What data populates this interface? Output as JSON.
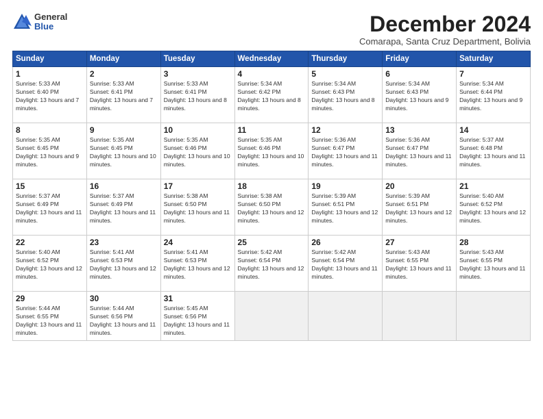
{
  "logo": {
    "general": "General",
    "blue": "Blue"
  },
  "title": "December 2024",
  "subtitle": "Comarapa, Santa Cruz Department, Bolivia",
  "days_of_week": [
    "Sunday",
    "Monday",
    "Tuesday",
    "Wednesday",
    "Thursday",
    "Friday",
    "Saturday"
  ],
  "weeks": [
    [
      {
        "day": 1,
        "sunrise": "5:33 AM",
        "sunset": "6:40 PM",
        "daylight": "13 hours and 7 minutes."
      },
      {
        "day": 2,
        "sunrise": "5:33 AM",
        "sunset": "6:41 PM",
        "daylight": "13 hours and 7 minutes."
      },
      {
        "day": 3,
        "sunrise": "5:33 AM",
        "sunset": "6:41 PM",
        "daylight": "13 hours and 8 minutes."
      },
      {
        "day": 4,
        "sunrise": "5:34 AM",
        "sunset": "6:42 PM",
        "daylight": "13 hours and 8 minutes."
      },
      {
        "day": 5,
        "sunrise": "5:34 AM",
        "sunset": "6:43 PM",
        "daylight": "13 hours and 8 minutes."
      },
      {
        "day": 6,
        "sunrise": "5:34 AM",
        "sunset": "6:43 PM",
        "daylight": "13 hours and 9 minutes."
      },
      {
        "day": 7,
        "sunrise": "5:34 AM",
        "sunset": "6:44 PM",
        "daylight": "13 hours and 9 minutes."
      }
    ],
    [
      {
        "day": 8,
        "sunrise": "5:35 AM",
        "sunset": "6:45 PM",
        "daylight": "13 hours and 9 minutes."
      },
      {
        "day": 9,
        "sunrise": "5:35 AM",
        "sunset": "6:45 PM",
        "daylight": "13 hours and 10 minutes."
      },
      {
        "day": 10,
        "sunrise": "5:35 AM",
        "sunset": "6:46 PM",
        "daylight": "13 hours and 10 minutes."
      },
      {
        "day": 11,
        "sunrise": "5:35 AM",
        "sunset": "6:46 PM",
        "daylight": "13 hours and 10 minutes."
      },
      {
        "day": 12,
        "sunrise": "5:36 AM",
        "sunset": "6:47 PM",
        "daylight": "13 hours and 11 minutes."
      },
      {
        "day": 13,
        "sunrise": "5:36 AM",
        "sunset": "6:47 PM",
        "daylight": "13 hours and 11 minutes."
      },
      {
        "day": 14,
        "sunrise": "5:37 AM",
        "sunset": "6:48 PM",
        "daylight": "13 hours and 11 minutes."
      }
    ],
    [
      {
        "day": 15,
        "sunrise": "5:37 AM",
        "sunset": "6:49 PM",
        "daylight": "13 hours and 11 minutes."
      },
      {
        "day": 16,
        "sunrise": "5:37 AM",
        "sunset": "6:49 PM",
        "daylight": "13 hours and 11 minutes."
      },
      {
        "day": 17,
        "sunrise": "5:38 AM",
        "sunset": "6:50 PM",
        "daylight": "13 hours and 11 minutes."
      },
      {
        "day": 18,
        "sunrise": "5:38 AM",
        "sunset": "6:50 PM",
        "daylight": "13 hours and 12 minutes."
      },
      {
        "day": 19,
        "sunrise": "5:39 AM",
        "sunset": "6:51 PM",
        "daylight": "13 hours and 12 minutes."
      },
      {
        "day": 20,
        "sunrise": "5:39 AM",
        "sunset": "6:51 PM",
        "daylight": "13 hours and 12 minutes."
      },
      {
        "day": 21,
        "sunrise": "5:40 AM",
        "sunset": "6:52 PM",
        "daylight": "13 hours and 12 minutes."
      }
    ],
    [
      {
        "day": 22,
        "sunrise": "5:40 AM",
        "sunset": "6:52 PM",
        "daylight": "13 hours and 12 minutes."
      },
      {
        "day": 23,
        "sunrise": "5:41 AM",
        "sunset": "6:53 PM",
        "daylight": "13 hours and 12 minutes."
      },
      {
        "day": 24,
        "sunrise": "5:41 AM",
        "sunset": "6:53 PM",
        "daylight": "13 hours and 12 minutes."
      },
      {
        "day": 25,
        "sunrise": "5:42 AM",
        "sunset": "6:54 PM",
        "daylight": "13 hours and 12 minutes."
      },
      {
        "day": 26,
        "sunrise": "5:42 AM",
        "sunset": "6:54 PM",
        "daylight": "13 hours and 11 minutes."
      },
      {
        "day": 27,
        "sunrise": "5:43 AM",
        "sunset": "6:55 PM",
        "daylight": "13 hours and 11 minutes."
      },
      {
        "day": 28,
        "sunrise": "5:43 AM",
        "sunset": "6:55 PM",
        "daylight": "13 hours and 11 minutes."
      }
    ],
    [
      {
        "day": 29,
        "sunrise": "5:44 AM",
        "sunset": "6:55 PM",
        "daylight": "13 hours and 11 minutes."
      },
      {
        "day": 30,
        "sunrise": "5:44 AM",
        "sunset": "6:56 PM",
        "daylight": "13 hours and 11 minutes."
      },
      {
        "day": 31,
        "sunrise": "5:45 AM",
        "sunset": "6:56 PM",
        "daylight": "13 hours and 11 minutes."
      },
      null,
      null,
      null,
      null
    ]
  ]
}
